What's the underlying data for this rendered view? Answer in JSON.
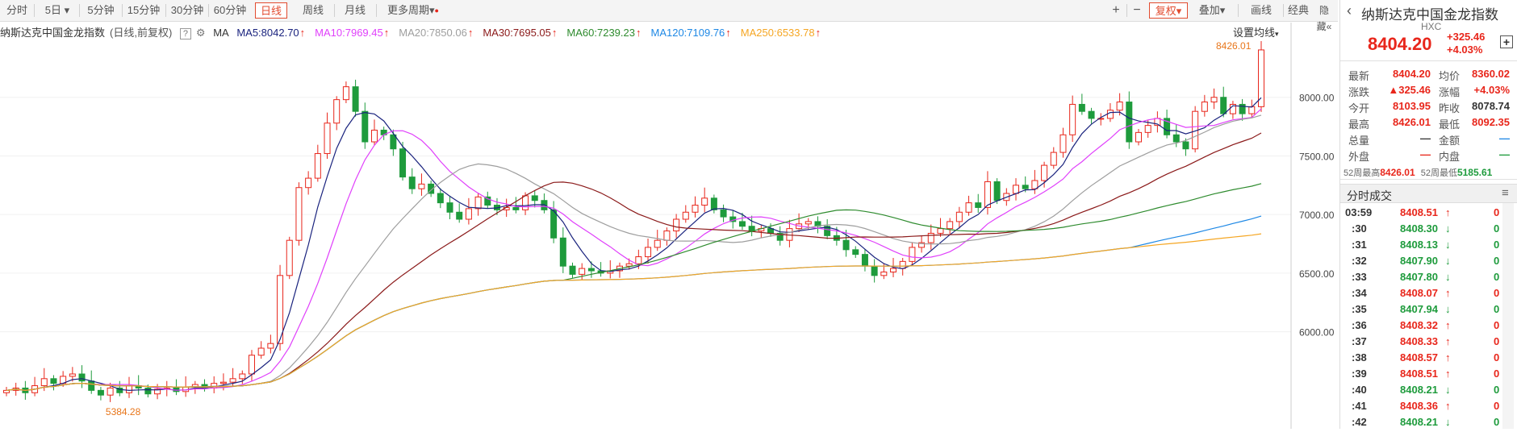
{
  "toolbar": {
    "periods": [
      "分时",
      "5日",
      "5分钟",
      "15分钟",
      "30分钟",
      "60分钟",
      "日线",
      "周线",
      "月线",
      "更多周期"
    ],
    "active": "日线",
    "right_buttons": [
      "+",
      "−",
      "复权",
      "叠加",
      "画线",
      "经典",
      "隐藏"
    ],
    "five_day_arrow": "▾",
    "more_arrow": "▾",
    "fq_arrow": "▾",
    "overlay_arrow": "▾",
    "hide_arrows": "«",
    "close": "✕"
  },
  "legend": {
    "name": "纳斯达克中国金龙指数",
    "mode": "(日线,前复权)",
    "help": "?",
    "gear": "⚙",
    "ma": "MA",
    "items": [
      {
        "label": "MA5:8042.70",
        "arrow": "↑",
        "color": "#1a237e"
      },
      {
        "label": "MA10:7969.45",
        "arrow": "↑",
        "color": "#e040fb"
      },
      {
        "label": "MA20:7850.06",
        "arrow": "↑",
        "color": "#9e9e9e"
      },
      {
        "label": "MA30:7695.05",
        "arrow": "↑",
        "color": "#8b1a1a"
      },
      {
        "label": "MA60:7239.23",
        "arrow": "↑",
        "color": "#2e8b2e"
      },
      {
        "label": "MA120:7109.76",
        "arrow": "↑",
        "color": "#1e88e5"
      },
      {
        "label": "MA250:6533.78",
        "arrow": "↑",
        "color": "#f5a623"
      }
    ],
    "settings": "设置均线"
  },
  "chart_data": {
    "type": "candlestick",
    "title": "纳斯达克中国金龙指数",
    "y_ticks": [
      8000,
      7500,
      7000,
      6500,
      6000
    ],
    "ylim": [
      5200,
      8500
    ],
    "annotations": {
      "high": "8426.01",
      "low": "5384.28"
    },
    "closes": [
      5500,
      5520,
      5480,
      5540,
      5600,
      5560,
      5620,
      5640,
      5580,
      5500,
      5460,
      5520,
      5480,
      5540,
      5520,
      5470,
      5510,
      5520,
      5490,
      5530,
      5550,
      5520,
      5560,
      5570,
      5600,
      5640,
      5800,
      5860,
      5900,
      6480,
      6780,
      7230,
      7310,
      7520,
      7780,
      7980,
      8090,
      7880,
      7620,
      7720,
      7680,
      7560,
      7320,
      7220,
      7260,
      7180,
      7100,
      7020,
      6960,
      7050,
      7150,
      7080,
      7040,
      7060,
      7040,
      7160,
      7120,
      7040,
      6800,
      6560,
      6490,
      6540,
      6520,
      6500,
      6520,
      6560,
      6580,
      6640,
      6720,
      6780,
      6860,
      6960,
      7020,
      7080,
      7140,
      7040,
      6980,
      6940,
      6900,
      6860,
      6880,
      6840,
      6780,
      6880,
      6920,
      6940,
      6900,
      6820,
      6780,
      6700,
      6660,
      6560,
      6480,
      6510,
      6540,
      6600,
      6720,
      6760,
      6840,
      6880,
      6940,
      7020,
      7100,
      7060,
      7280,
      7120,
      7180,
      7250,
      7220,
      7290,
      7420,
      7530,
      7680,
      7940,
      7880,
      7820,
      7820,
      7890,
      7960,
      7620,
      7700,
      7760,
      7820,
      7680,
      7620,
      7560,
      7880,
      7960,
      8000,
      7860,
      7940,
      7860,
      7920,
      8404.2
    ]
  },
  "info": {
    "title": "纳斯达克中国金龙指数",
    "code": "HXC",
    "price": "8404.20",
    "chg": "+325.46",
    "pct": "+4.03%",
    "plus": "+",
    "rows": [
      {
        "l1": "最新",
        "v1": "8404.20",
        "c1": "red",
        "l2": "均价",
        "v2": "8360.02",
        "c2": "red"
      },
      {
        "l1": "涨跌",
        "v1": "▲325.46",
        "c1": "red",
        "l2": "涨幅",
        "v2": "+4.03%",
        "c2": "red"
      },
      {
        "l1": "今开",
        "v1": "8103.95",
        "c1": "red",
        "l2": "昨收",
        "v2": "8078.74",
        "c2": ""
      },
      {
        "l1": "最高",
        "v1": "8426.01",
        "c1": "red",
        "l2": "最低",
        "v2": "8092.35",
        "c2": "red"
      },
      {
        "l1": "总量",
        "v1": "—",
        "c1": "",
        "l2": "金额",
        "v2": "—",
        "c2": "blue"
      },
      {
        "l1": "外盘",
        "v1": "—",
        "c1": "red",
        "l2": "内盘",
        "v2": "—",
        "c2": "green"
      }
    ],
    "w52": {
      "hl": "52周最高",
      "hv": "8426.01",
      "ll": "52周最低",
      "lv": "5185.61"
    }
  },
  "trades": {
    "title": "分时成交",
    "menu": "≡",
    "rows": [
      {
        "t": "03:59",
        "p": "8408.51",
        "d": "↑",
        "v": "0",
        "c": "red"
      },
      {
        "t": ":30",
        "p": "8408.30",
        "d": "↓",
        "v": "0",
        "c": "green"
      },
      {
        "t": ":31",
        "p": "8408.13",
        "d": "↓",
        "v": "0",
        "c": "green"
      },
      {
        "t": ":32",
        "p": "8407.90",
        "d": "↓",
        "v": "0",
        "c": "green"
      },
      {
        "t": ":33",
        "p": "8407.80",
        "d": "↓",
        "v": "0",
        "c": "green"
      },
      {
        "t": ":34",
        "p": "8408.07",
        "d": "↑",
        "v": "0",
        "c": "red"
      },
      {
        "t": ":35",
        "p": "8407.94",
        "d": "↓",
        "v": "0",
        "c": "green"
      },
      {
        "t": ":36",
        "p": "8408.32",
        "d": "↑",
        "v": "0",
        "c": "red"
      },
      {
        "t": ":37",
        "p": "8408.33",
        "d": "↑",
        "v": "0",
        "c": "red"
      },
      {
        "t": ":38",
        "p": "8408.57",
        "d": "↑",
        "v": "0",
        "c": "red"
      },
      {
        "t": ":39",
        "p": "8408.51",
        "d": "↑",
        "v": "0",
        "c": "red"
      },
      {
        "t": ":40",
        "p": "8408.21",
        "d": "↓",
        "v": "0",
        "c": "green"
      },
      {
        "t": ":41",
        "p": "8408.36",
        "d": "↑",
        "v": "0",
        "c": "red"
      },
      {
        "t": ":42",
        "p": "8408.21",
        "d": "↓",
        "v": "0",
        "c": "green"
      }
    ]
  },
  "colors": {
    "up": "#e8261b",
    "down": "#1e9b3c",
    "accent": "#e24b2f"
  }
}
